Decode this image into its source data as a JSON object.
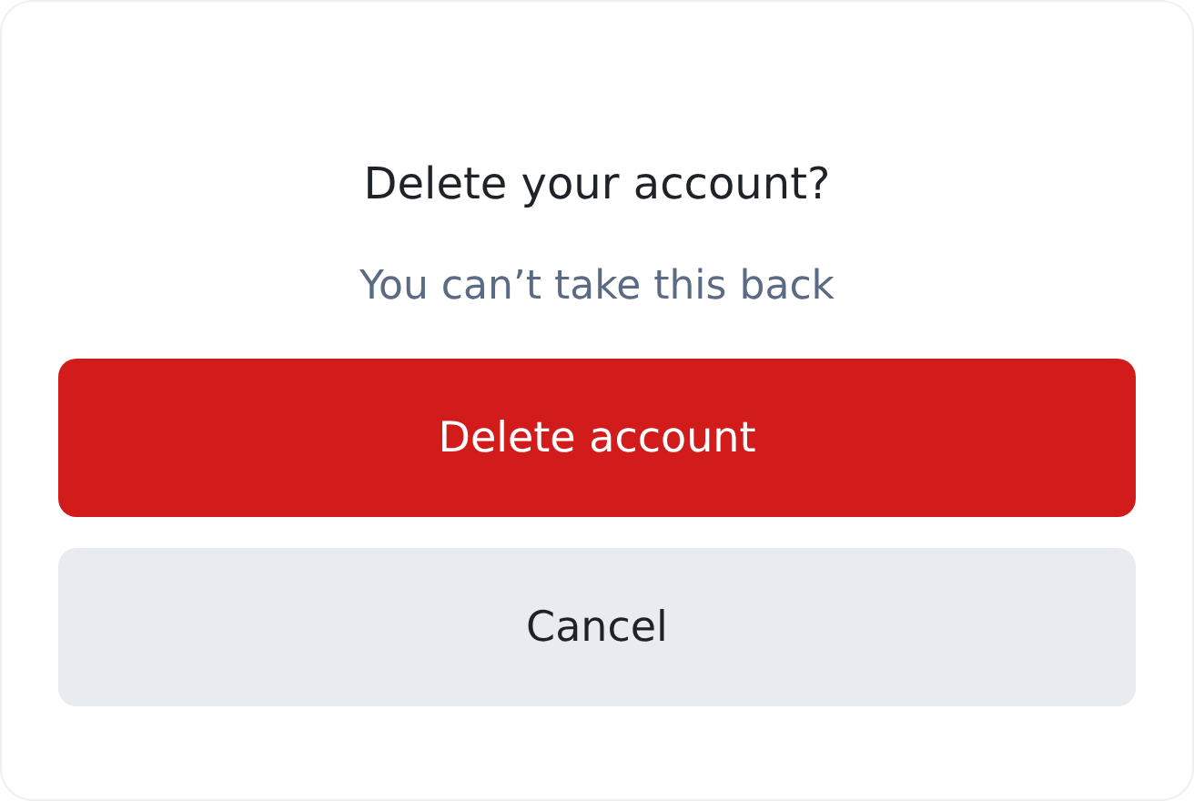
{
  "dialog": {
    "title": "Delete your account?",
    "subtitle": "You can’t take this back",
    "buttons": [
      {
        "label": "Delete account",
        "kind": "danger"
      },
      {
        "label": "Cancel",
        "kind": "secondary"
      }
    ]
  }
}
